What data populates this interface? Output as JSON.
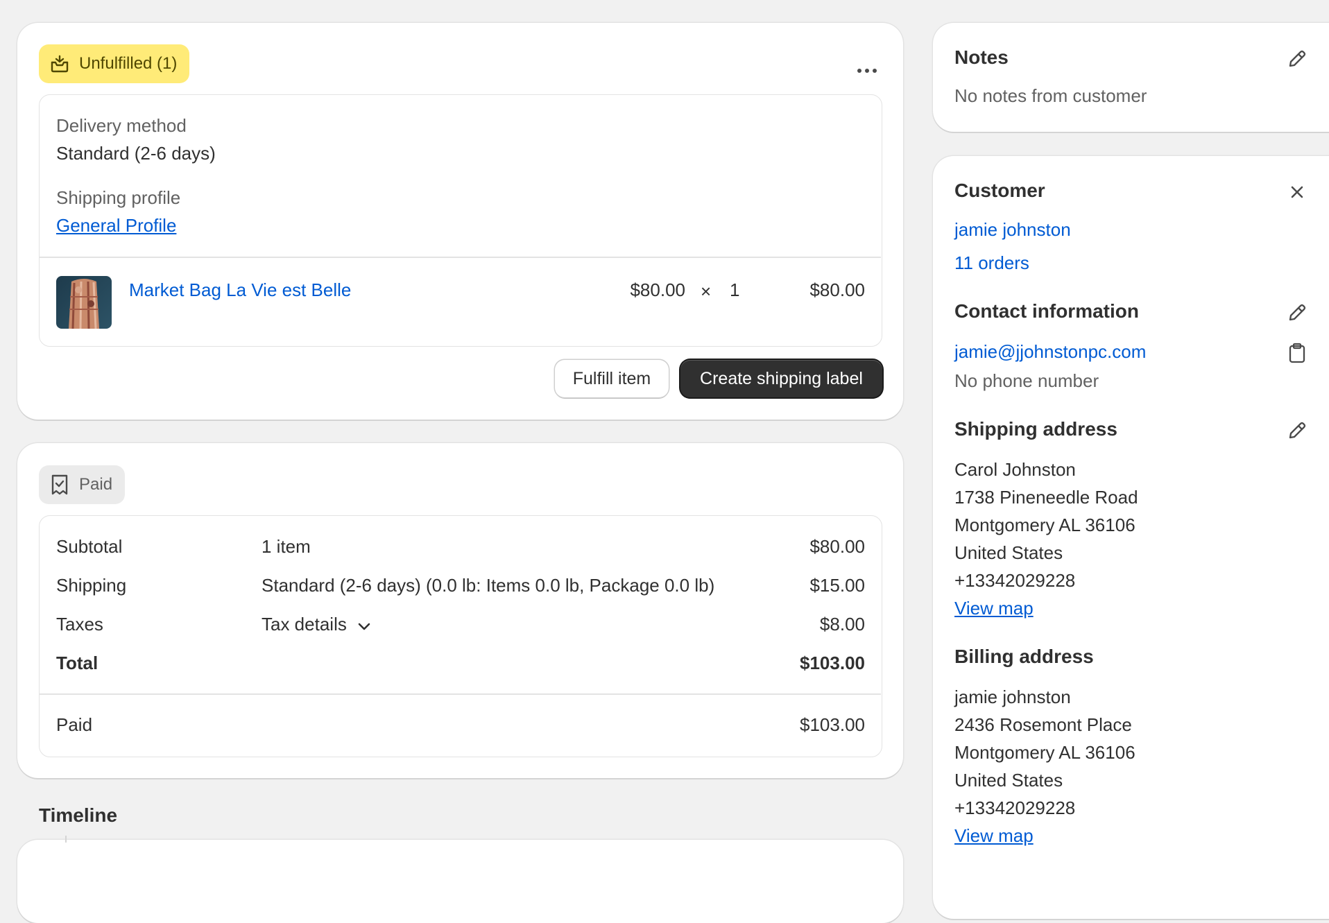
{
  "fulfillment": {
    "badge_label": "Unfulfilled (1)",
    "delivery_method_label": "Delivery method",
    "delivery_method_value": "Standard (2-6 days)",
    "shipping_profile_label": "Shipping profile",
    "shipping_profile_link": "General Profile",
    "item": {
      "name": "Market Bag La Vie est Belle",
      "unit_price": "$80.00",
      "times": "×",
      "quantity": "1",
      "line_total": "$80.00"
    },
    "fulfill_button": "Fulfill item",
    "shipping_label_button": "Create shipping label",
    "more_icon": "ellipsis-horizontal-icon"
  },
  "payment": {
    "badge_label": "Paid",
    "rows": {
      "subtotal": {
        "label": "Subtotal",
        "detail": "1 item",
        "amount": "$80.00"
      },
      "shipping": {
        "label": "Shipping",
        "detail": "Standard (2-6 days) (0.0 lb: Items 0.0 lb, Package 0.0 lb)",
        "amount": "$15.00"
      },
      "taxes": {
        "label": "Taxes",
        "detail": "Tax details",
        "amount": "$8.00"
      },
      "total": {
        "label": "Total",
        "amount": "$103.00"
      },
      "paid": {
        "label": "Paid",
        "amount": "$103.00"
      }
    }
  },
  "timeline": {
    "title": "Timeline"
  },
  "notes": {
    "title": "Notes",
    "text": "No notes from customer"
  },
  "customer": {
    "title": "Customer",
    "name": "jamie johnston",
    "orders": "11 orders",
    "contact_title": "Contact information",
    "email": "jamie@jjohnstonpc.com",
    "phone": "No phone number",
    "shipping_title": "Shipping address",
    "shipping_lines": [
      "Carol Johnston",
      "1738 Pineneedle Road",
      "Montgomery AL 36106",
      "United States",
      "+13342029228"
    ],
    "shipping_map": "View map",
    "billing_title": "Billing address",
    "billing_lines": [
      "jamie johnston",
      "2436 Rosemont Place",
      "Montgomery AL 36106",
      "United States",
      "+13342029228"
    ],
    "billing_map": "View map"
  },
  "colors": {
    "accent_link": "#005bd3",
    "unfulfilled_badge": "#ffeb78",
    "paid_badge": "#ebebeb",
    "primary_button": "#303030"
  }
}
